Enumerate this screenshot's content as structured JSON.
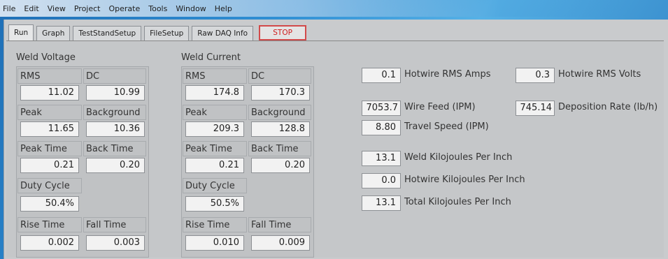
{
  "menu": [
    "File",
    "Edit",
    "View",
    "Project",
    "Operate",
    "Tools",
    "Window",
    "Help"
  ],
  "tabs": [
    "Run",
    "Graph",
    "TestStandSetup",
    "FileSetup",
    "Raw DAQ Info"
  ],
  "stop_label": "STOP",
  "voltage": {
    "title": "Weld Voltage",
    "rms_label": "RMS",
    "dc_label": "DC",
    "rms": "11.02",
    "dc": "10.99",
    "peak_label": "Peak",
    "background_label": "Background",
    "peak": "11.65",
    "background": "10.36",
    "peak_time_label": "Peak Time",
    "back_time_label": "Back Time",
    "peak_time": "0.21",
    "back_time": "0.20",
    "duty_label": "Duty Cycle",
    "duty": "50.4%",
    "rise_label": "Rise Time",
    "fall_label": "Fall Time",
    "rise": "0.002",
    "fall": "0.003"
  },
  "current": {
    "title": "Weld Current",
    "rms_label": "RMS",
    "dc_label": "DC",
    "rms": "174.8",
    "dc": "170.3",
    "peak_label": "Peak",
    "background_label": "Background",
    "peak": "209.3",
    "background": "128.8",
    "peak_time_label": "Peak Time",
    "back_time_label": "Back Time",
    "peak_time": "0.21",
    "back_time": "0.20",
    "duty_label": "Duty Cycle",
    "duty": "50.5%",
    "rise_label": "Rise Time",
    "fall_label": "Fall Time",
    "rise": "0.010",
    "fall": "0.009"
  },
  "hotwire": {
    "amps_value": "0.1",
    "amps_label": "Hotwire RMS Amps",
    "volts_value": "0.3",
    "volts_label": "Hotwire RMS Volts"
  },
  "feed": {
    "wire_value": "7053.7",
    "wire_label": "Wire Feed (IPM)",
    "deposition_value": "745.14",
    "deposition_label": "Deposition Rate (lb/h)",
    "travel_value": "8.80",
    "travel_label": "Travel Speed (IPM)"
  },
  "kj": {
    "weld_value": "13.1",
    "weld_label": "Weld Kilojoules Per Inch",
    "hotwire_value": "0.0",
    "hotwire_label": "Hotwire Kilojoules Per Inch",
    "total_value": "13.1",
    "total_label": "Total Kilojoules Per Inch"
  }
}
